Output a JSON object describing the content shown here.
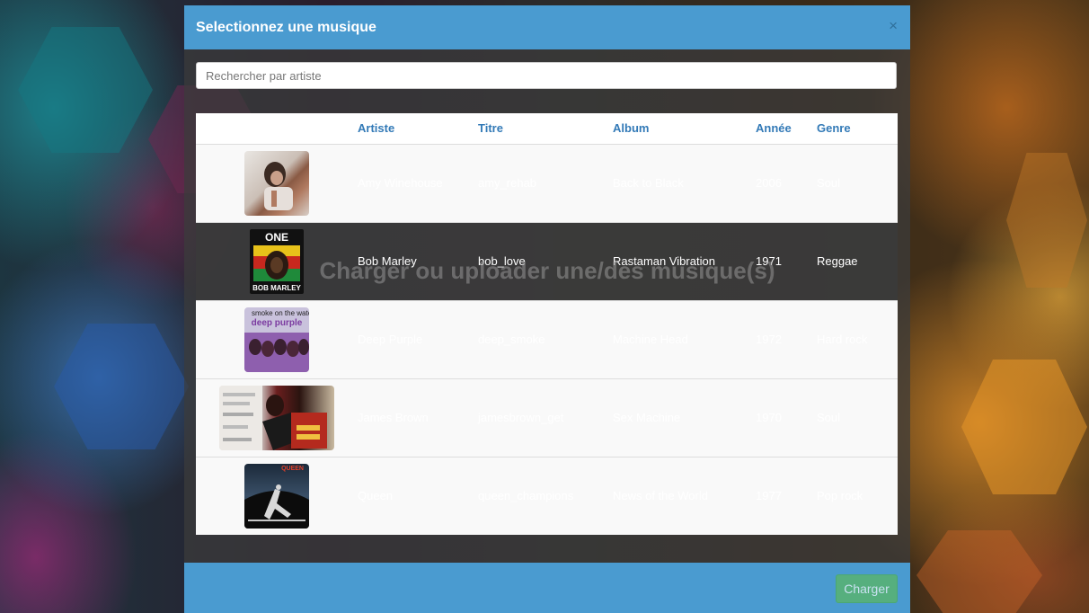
{
  "modal": {
    "title": "Selectionnez une musique",
    "close_label": "×",
    "overlay_text": "Charger ou uploader une/des musique(s)"
  },
  "search": {
    "placeholder": "Rechercher par artiste",
    "value": ""
  },
  "table": {
    "headers": [
      "",
      "Artiste",
      "Titre",
      "Album",
      "Année",
      "Genre"
    ],
    "rows": [
      {
        "artist": "Amy Winehouse",
        "title": "amy_rehab",
        "album": "Back to Black",
        "year": "2006",
        "genre": "Soul",
        "selected": false
      },
      {
        "artist": "Bob Marley",
        "title": "bob_love",
        "album": "Rastaman Vibration",
        "year": "1971",
        "genre": "Reggae",
        "selected": true,
        "cover_text_top": "ONE LOVE",
        "cover_text_bottom": "BOB MARLEY"
      },
      {
        "artist": "Deep Purple",
        "title": "deep_smoke",
        "album": "Machine Head",
        "year": "1972",
        "genre": "Hard rock",
        "selected": false,
        "cover_text_top": "smoke on the water",
        "cover_text_bottom": "deep purple"
      },
      {
        "artist": "James Brown",
        "title": "jamesbrown_get",
        "album": "Sex Machine",
        "year": "1970",
        "genre": "Soul",
        "selected": false
      },
      {
        "artist": "Queen",
        "title": "queen_champions",
        "album": "News of the World",
        "year": "1977",
        "genre": "Pop rock",
        "selected": false,
        "cover_text_top": "QUEEN"
      }
    ]
  },
  "footer": {
    "charger_label": "Charger"
  },
  "colors": {
    "header": "#4a9bd0",
    "link": "#337ab7",
    "button": "#5cb85c"
  }
}
